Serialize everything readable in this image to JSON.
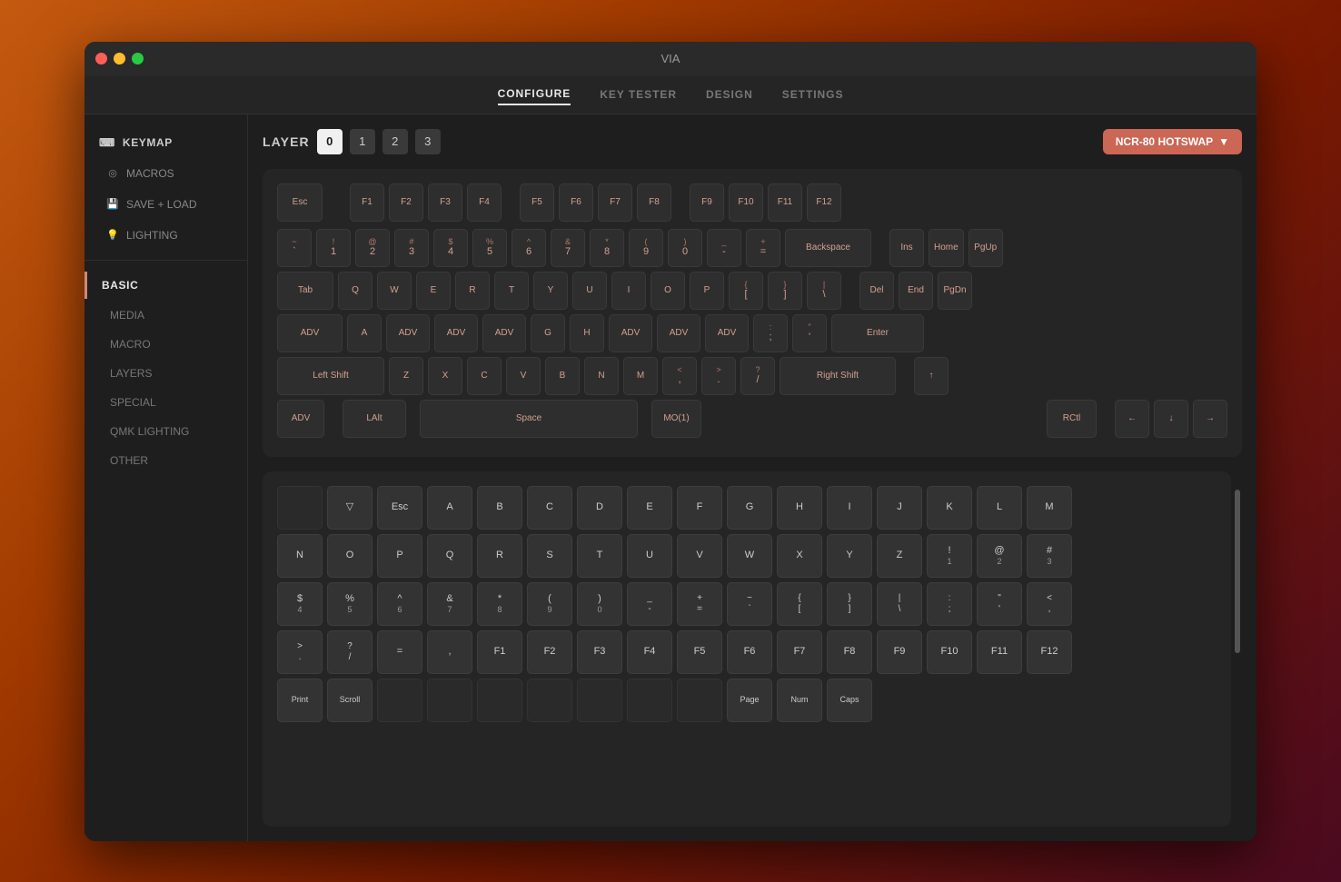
{
  "window": {
    "title": "VIA"
  },
  "nav": {
    "items": [
      {
        "label": "CONFIGURE",
        "active": true
      },
      {
        "label": "KEY TESTER",
        "active": false
      },
      {
        "label": "DESIGN",
        "active": false
      },
      {
        "label": "SETTINGS",
        "active": false
      }
    ]
  },
  "sidebar": {
    "keymap_label": "KEYMAP",
    "macros_label": "MACROS",
    "save_load_label": "SAVE + LOAD",
    "lighting_label": "LIGHTING",
    "basic_label": "BASIC",
    "media_label": "MEDIA",
    "macro_label": "MACRO",
    "layers_label": "LAYERS",
    "special_label": "SPECIAL",
    "qmk_lighting_label": "QMK LIGHTING",
    "other_label": "OTHER"
  },
  "layer": {
    "label": "LAYER",
    "buttons": [
      "0",
      "1",
      "2",
      "3"
    ],
    "active": 0
  },
  "keyboard_selector": {
    "label": "NCR-80 HOTSWAP",
    "chevron": "▼"
  },
  "keyboard": {
    "row1": [
      {
        "label": "Esc",
        "width": "normal"
      },
      {
        "label": "F1"
      },
      {
        "label": "F2"
      },
      {
        "label": "F3"
      },
      {
        "label": "F4"
      },
      {
        "label": "F5"
      },
      {
        "label": "F6"
      },
      {
        "label": "F7"
      },
      {
        "label": "F8"
      },
      {
        "label": "F9"
      },
      {
        "label": "F10"
      },
      {
        "label": "F11"
      },
      {
        "label": "F12"
      }
    ],
    "row2": [
      {
        "top": "~",
        "main": "`"
      },
      {
        "top": "!",
        "main": "1"
      },
      {
        "top": "@",
        "main": "2"
      },
      {
        "top": "#",
        "main": "3"
      },
      {
        "top": "$",
        "main": "4"
      },
      {
        "top": "%",
        "main": "5"
      },
      {
        "top": "^",
        "main": "6"
      },
      {
        "top": "&",
        "main": "7"
      },
      {
        "top": "*",
        "main": "8"
      },
      {
        "top": "(",
        "main": "9"
      },
      {
        "top": ")",
        "main": "0"
      },
      {
        "top": "_",
        "main": "-"
      },
      {
        "top": "+",
        "main": "="
      },
      {
        "label": "Backspace",
        "wide": true
      },
      {
        "label": "Ins"
      },
      {
        "label": "Home"
      },
      {
        "label": "PgUp"
      }
    ],
    "row3": [
      {
        "label": "Tab",
        "wide": true
      },
      {
        "label": "Q"
      },
      {
        "label": "W"
      },
      {
        "label": "E"
      },
      {
        "label": "R"
      },
      {
        "label": "T"
      },
      {
        "label": "Y"
      },
      {
        "label": "U"
      },
      {
        "label": "I"
      },
      {
        "label": "O"
      },
      {
        "label": "P"
      },
      {
        "top": "{",
        "main": "["
      },
      {
        "top": "}",
        "main": "]"
      },
      {
        "top": "|",
        "main": "\\"
      },
      {
        "label": "Del"
      },
      {
        "label": "End"
      },
      {
        "label": "PgDn"
      }
    ],
    "row4": [
      {
        "label": "ADV",
        "wide": true
      },
      {
        "label": "A"
      },
      {
        "label": "ADV"
      },
      {
        "label": "ADV"
      },
      {
        "label": "ADV"
      },
      {
        "label": "G"
      },
      {
        "label": "H"
      },
      {
        "label": "ADV"
      },
      {
        "label": "ADV"
      },
      {
        "label": "ADV"
      },
      {
        "top": ":",
        "main": ";"
      },
      {
        "top": "\"",
        "main": "'"
      },
      {
        "label": "Enter",
        "wide": true
      }
    ],
    "row5": [
      {
        "label": "Left Shift",
        "wide": true
      },
      {
        "label": "Z"
      },
      {
        "label": "X"
      },
      {
        "label": "C"
      },
      {
        "label": "V"
      },
      {
        "label": "B"
      },
      {
        "label": "N"
      },
      {
        "label": "M"
      },
      {
        "top": "<",
        "main": ","
      },
      {
        "top": ">",
        "main": "."
      },
      {
        "top": "?",
        "main": "/"
      },
      {
        "label": "Right Shift",
        "wide": true
      },
      {
        "label": "↑"
      }
    ],
    "row6": [
      {
        "label": "ADV"
      },
      {
        "label": "LAlt",
        "wide": true
      },
      {
        "label": "Space",
        "wide": true
      },
      {
        "label": "MO(1)"
      },
      {
        "label": "RCtl"
      },
      {
        "label": "←"
      },
      {
        "label": "↓"
      },
      {
        "label": "→"
      }
    ]
  },
  "picker": {
    "rows": [
      [
        {
          "label": "",
          "empty": true
        },
        {
          "label": "▽"
        },
        {
          "label": "Esc"
        },
        {
          "label": "A"
        },
        {
          "label": "B"
        },
        {
          "label": "C"
        },
        {
          "label": "D"
        },
        {
          "label": "E"
        },
        {
          "label": "F"
        },
        {
          "label": "G"
        },
        {
          "label": "H"
        },
        {
          "label": "I"
        },
        {
          "label": "J"
        },
        {
          "label": "K"
        },
        {
          "label": "L"
        },
        {
          "label": "M"
        }
      ],
      [
        {
          "label": "N"
        },
        {
          "label": "O"
        },
        {
          "label": "P"
        },
        {
          "label": "Q"
        },
        {
          "label": "R"
        },
        {
          "label": "S"
        },
        {
          "label": "T"
        },
        {
          "label": "U"
        },
        {
          "label": "V"
        },
        {
          "label": "W"
        },
        {
          "label": "X"
        },
        {
          "label": "Y"
        },
        {
          "label": "Z"
        },
        {
          "top": "!",
          "sub": "1"
        },
        {
          "top": "@",
          "sub": "2"
        },
        {
          "top": "#",
          "sub": "3"
        }
      ],
      [
        {
          "top": "$",
          "sub": "4"
        },
        {
          "top": "%",
          "sub": "5"
        },
        {
          "top": "^",
          "sub": "6"
        },
        {
          "top": "&",
          "sub": "7"
        },
        {
          "top": "*",
          "sub": "8"
        },
        {
          "top": "(",
          "sub": "9"
        },
        {
          "top": ")",
          "sub": "0"
        },
        {
          "label": "_\n-"
        },
        {
          "label": "+\n="
        },
        {
          "label": "~\n`"
        },
        {
          "label": "{\n["
        },
        {
          "label": "}\n]"
        },
        {
          "label": "|\n\\"
        },
        {
          "label": ":\n;"
        },
        {
          "label": "\"\n'"
        },
        {
          "label": "<\n,"
        }
      ],
      [
        {
          "label": ">\n."
        },
        {
          "label": "?\n/"
        },
        {
          "label": "="
        },
        {
          "label": ","
        },
        {
          "label": "F1"
        },
        {
          "label": "F2"
        },
        {
          "label": "F3"
        },
        {
          "label": "F4"
        },
        {
          "label": "F5"
        },
        {
          "label": "F6"
        },
        {
          "label": "F7"
        },
        {
          "label": "F8"
        },
        {
          "label": "F9"
        },
        {
          "label": "F10"
        },
        {
          "label": "F11"
        },
        {
          "label": "F12"
        }
      ],
      [
        {
          "label": "Print"
        },
        {
          "label": "Scroll"
        },
        {
          "label": ""
        },
        {
          "label": ""
        },
        {
          "label": ""
        },
        {
          "label": ""
        },
        {
          "label": ""
        },
        {
          "label": ""
        },
        {
          "label": ""
        },
        {
          "label": "Page"
        },
        {
          "label": "Num"
        },
        {
          "label": "Caps"
        }
      ]
    ]
  }
}
